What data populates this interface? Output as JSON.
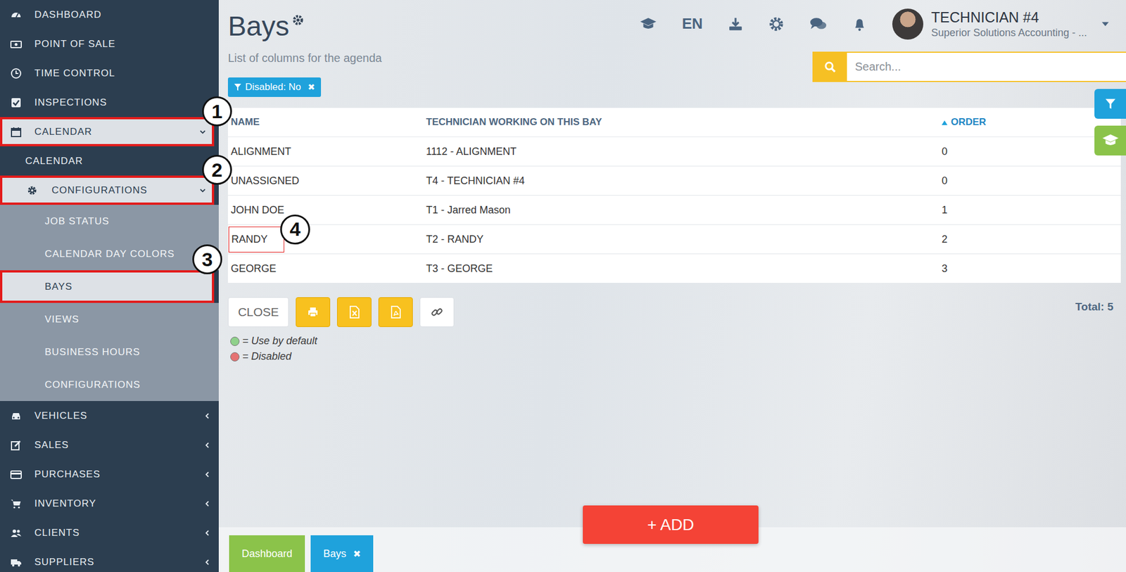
{
  "sidebar": {
    "items": [
      {
        "label": "DASHBOARD",
        "selected": false
      },
      {
        "label": "POINT OF SALE",
        "selected": false
      },
      {
        "label": "TIME CONTROL",
        "selected": false
      },
      {
        "label": "INSPECTIONS",
        "selected": false
      },
      {
        "label": "CALENDAR",
        "selected": false,
        "expanded": true,
        "callout": "1",
        "children": [
          {
            "label": "CALENDAR",
            "selected": false
          },
          {
            "label": "CONFIGURATIONS",
            "selected": false,
            "expanded": true,
            "callout": "2",
            "children": [
              {
                "label": "JOB STATUS",
                "selected": false
              },
              {
                "label": "CALENDAR DAY COLORS",
                "selected": false
              },
              {
                "label": "BAYS",
                "selected": true,
                "callout": "3"
              },
              {
                "label": "VIEWS",
                "selected": false
              },
              {
                "label": "BUSINESS HOURS",
                "selected": false
              },
              {
                "label": "CONFIGURATIONS",
                "selected": false
              }
            ]
          }
        ]
      },
      {
        "label": "VEHICLES",
        "selected": false,
        "expanded": false
      },
      {
        "label": "SALES",
        "selected": false,
        "expanded": false
      },
      {
        "label": "PURCHASES",
        "selected": false,
        "expanded": false
      },
      {
        "label": "INVENTORY",
        "selected": false,
        "expanded": false
      },
      {
        "label": "CLIENTS",
        "selected": false,
        "expanded": false
      },
      {
        "label": "SUPPLIERS",
        "selected": false,
        "expanded": false
      }
    ]
  },
  "page": {
    "title": "Bays",
    "subtitle": "List of columns for the agenda"
  },
  "topbar": {
    "language": "EN",
    "user": {
      "name": "TECHNICIAN #4",
      "company": "Superior Solutions Accounting - ..."
    }
  },
  "search": {
    "placeholder": "Search..."
  },
  "filter_chip": {
    "label": "Disabled: No",
    "remove": "✖"
  },
  "table": {
    "columns": [
      {
        "label": "NAME",
        "sorted": false
      },
      {
        "label": "TECHNICIAN WORKING ON THIS BAY",
        "sorted": false
      },
      {
        "label": "ORDER",
        "sorted": true
      }
    ],
    "rows": [
      {
        "name": "ALIGNMENT",
        "technician": "1112 - ALIGNMENT",
        "order": "0"
      },
      {
        "name": "UNASSIGNED",
        "technician": "T4 - TECHNICIAN #4",
        "order": "0"
      },
      {
        "name": "JOHN DOE",
        "technician": "T1 - Jarred Mason",
        "order": "1"
      },
      {
        "name": "RANDY",
        "technician": "T2 - RANDY",
        "order": "2",
        "callout": "4"
      },
      {
        "name": "GEORGE",
        "technician": "T3 - GEORGE",
        "order": "3"
      }
    ]
  },
  "actions": {
    "close": "CLOSE",
    "total": "Total: 5"
  },
  "legend": [
    {
      "label": "= Use by default",
      "color": "#8fd18b"
    },
    {
      "label": "= Disabled",
      "color": "#e57373"
    }
  ],
  "add_button": "+ ADD",
  "bottom_tabs": [
    {
      "label": "Dashboard",
      "selected": false,
      "color": "#8bc34a"
    },
    {
      "label": "Bays",
      "selected": true,
      "color": "#1fa2dc",
      "close": "✖"
    }
  ]
}
